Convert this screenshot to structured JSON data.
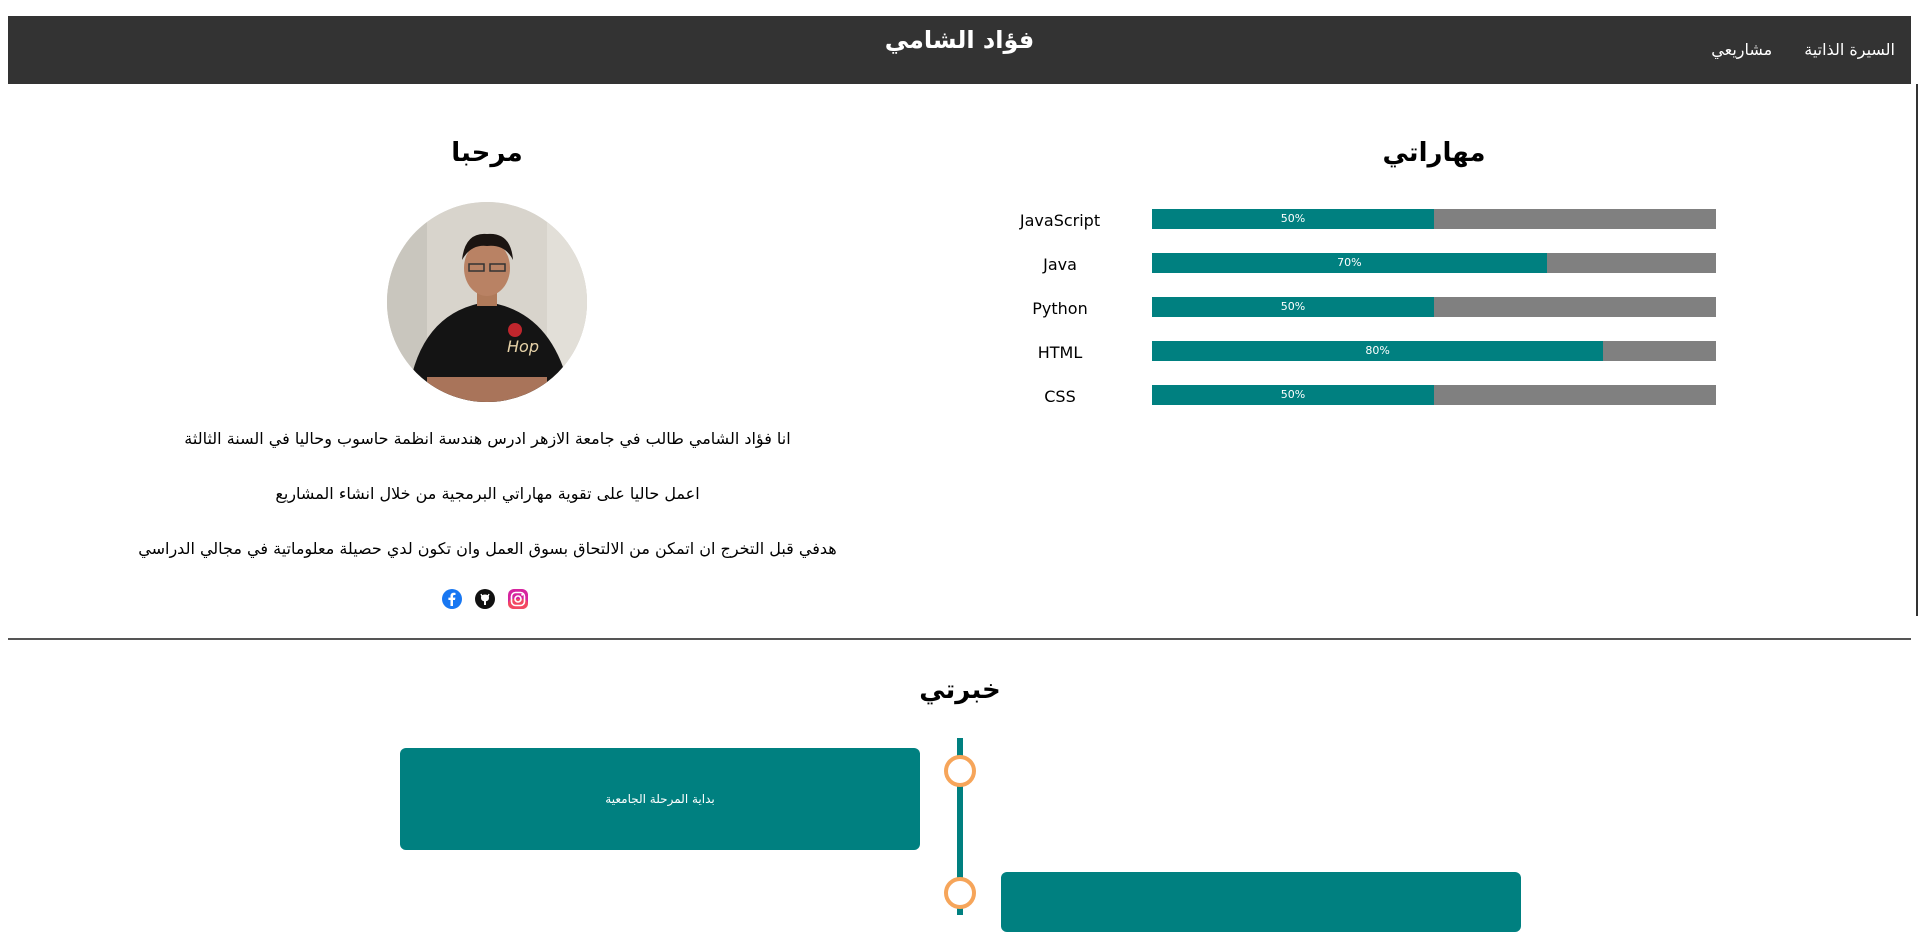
{
  "header": {
    "title": "فؤاد الشامي",
    "nav": [
      "السيرة الذاتية",
      "مشاريعي"
    ]
  },
  "about": {
    "heading": "مرحبا",
    "bio": [
      "انا فؤاد الشامي طالب في جامعة الازهر ادرس هندسة انظمة حاسوب وحاليا في السنة الثالثة",
      "اعمل حاليا على تقوية مهاراتي البرمجية من خلال انشاء المشاريع",
      "هدفي قبل التخرج ان اتمكن من الالتحاق بسوق العمل وان تكون لدي حصيلة معلوماتية في مجالي الدراسي"
    ],
    "social_icons": [
      "facebook-icon",
      "github-icon",
      "instagram-icon"
    ]
  },
  "skills": {
    "heading": "مهاراتي",
    "items": [
      {
        "name": "JavaScript",
        "percent": 50,
        "label": "50%"
      },
      {
        "name": "Java",
        "percent": 70,
        "label": "70%"
      },
      {
        "name": "Python",
        "percent": 50,
        "label": "50%"
      },
      {
        "name": "HTML",
        "percent": 80,
        "label": "80%"
      },
      {
        "name": "CSS",
        "percent": 50,
        "label": "50%"
      }
    ]
  },
  "experience": {
    "heading": "خبرتي",
    "items": [
      {
        "text": "بداية المرحلة الجامعية"
      },
      {
        "text": ""
      }
    ]
  },
  "colors": {
    "header_bg": "#333333",
    "accent": "#008080",
    "track": "#808080",
    "timeline_dot": "#f6a55a"
  }
}
